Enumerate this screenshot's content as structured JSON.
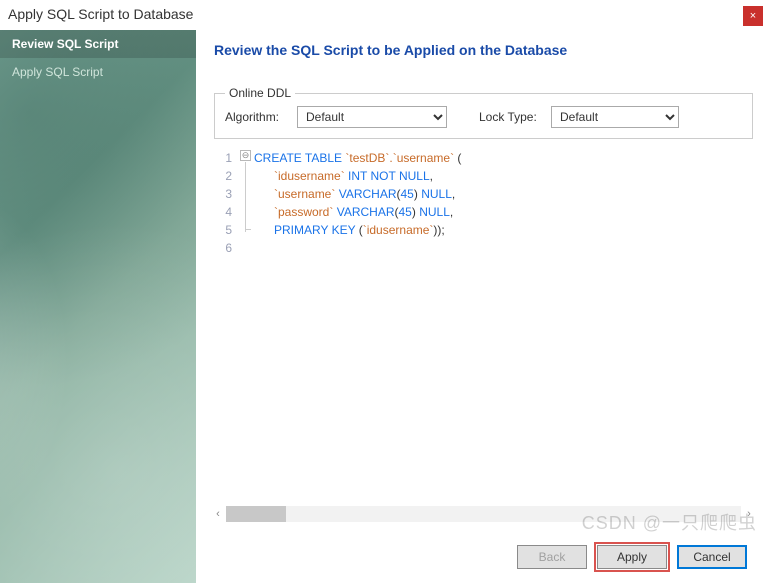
{
  "window": {
    "title": "Apply SQL Script to Database",
    "close_icon": "×"
  },
  "sidebar": {
    "items": [
      {
        "label": "Review SQL Script",
        "active": true
      },
      {
        "label": "Apply SQL Script",
        "active": false
      }
    ]
  },
  "heading": "Review the SQL Script to be Applied on the Database",
  "ddl": {
    "legend": "Online DDL",
    "algorithm_label": "Algorithm:",
    "algorithm_value": "Default",
    "locktype_label": "Lock Type:",
    "locktype_value": "Default"
  },
  "code": {
    "line_numbers": [
      "1",
      "2",
      "3",
      "4",
      "5",
      "6"
    ],
    "fold_symbol": "⊖",
    "lines": [
      {
        "indent": 0,
        "tokens": [
          {
            "t": "CREATE TABLE",
            "c": "kw"
          },
          {
            "t": " ",
            "c": "plain"
          },
          {
            "t": "`testDB`.`username`",
            "c": "str"
          },
          {
            "t": " (",
            "c": "plain"
          }
        ]
      },
      {
        "indent": 1,
        "tokens": [
          {
            "t": "`idusername`",
            "c": "str"
          },
          {
            "t": " ",
            "c": "plain"
          },
          {
            "t": "INT NOT NULL",
            "c": "kw"
          },
          {
            "t": ",",
            "c": "plain"
          }
        ]
      },
      {
        "indent": 1,
        "tokens": [
          {
            "t": "`username`",
            "c": "str"
          },
          {
            "t": " ",
            "c": "plain"
          },
          {
            "t": "VARCHAR",
            "c": "kw"
          },
          {
            "t": "(",
            "c": "plain"
          },
          {
            "t": "45",
            "c": "num"
          },
          {
            "t": ") ",
            "c": "plain"
          },
          {
            "t": "NULL",
            "c": "kw"
          },
          {
            "t": ",",
            "c": "plain"
          }
        ]
      },
      {
        "indent": 1,
        "tokens": [
          {
            "t": "`password`",
            "c": "str"
          },
          {
            "t": " ",
            "c": "plain"
          },
          {
            "t": "VARCHAR",
            "c": "kw"
          },
          {
            "t": "(",
            "c": "plain"
          },
          {
            "t": "45",
            "c": "num"
          },
          {
            "t": ") ",
            "c": "plain"
          },
          {
            "t": "NULL",
            "c": "kw"
          },
          {
            "t": ",",
            "c": "plain"
          }
        ]
      },
      {
        "indent": 1,
        "tokens": [
          {
            "t": "PRIMARY KEY",
            "c": "kw"
          },
          {
            "t": " (",
            "c": "plain"
          },
          {
            "t": "`idusername`",
            "c": "str"
          },
          {
            "t": "));",
            "c": "plain"
          }
        ]
      },
      {
        "indent": 0,
        "tokens": []
      }
    ]
  },
  "scrollbar": {
    "left_arrow": "‹",
    "right_arrow": "›"
  },
  "buttons": {
    "back": "Back",
    "apply": "Apply",
    "cancel": "Cancel"
  },
  "watermark": "CSDN @一只爬爬虫"
}
